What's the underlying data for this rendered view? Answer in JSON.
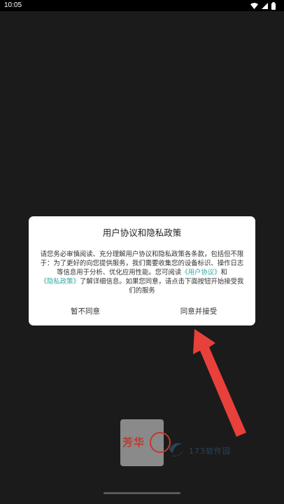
{
  "status_bar": {
    "time": "10:05",
    "icons": [
      "wifi-icon",
      "signal-icon",
      "battery-icon"
    ]
  },
  "dialog": {
    "title": "用户协议和隐私政策",
    "body_part1": "请您务必审慎阅读、充分理解用户协议和隐私政策各条款，包括但不限于：为了更好的向您提供服务，我们需要收集您的设备标识、操作日志等信息用于分析、优化应用性能。您可阅读",
    "link_user_agreement": "《用户协议》",
    "body_and": "和",
    "link_privacy_policy": "《隐私政策》",
    "body_part2": "了解详细信息。如果您同意，请点击下面按钮开始接受我们的服务",
    "decline_label": "暂不同意",
    "accept_label": "同意并接受"
  },
  "logo": {
    "text": "芳华"
  },
  "watermark": {
    "text": "173软件园"
  },
  "colors": {
    "background": "#1b1b1b",
    "dialog": "#ffffff",
    "link": "#2ea8a0",
    "arrow": "#e8403a",
    "logo_red": "#c0392b"
  }
}
